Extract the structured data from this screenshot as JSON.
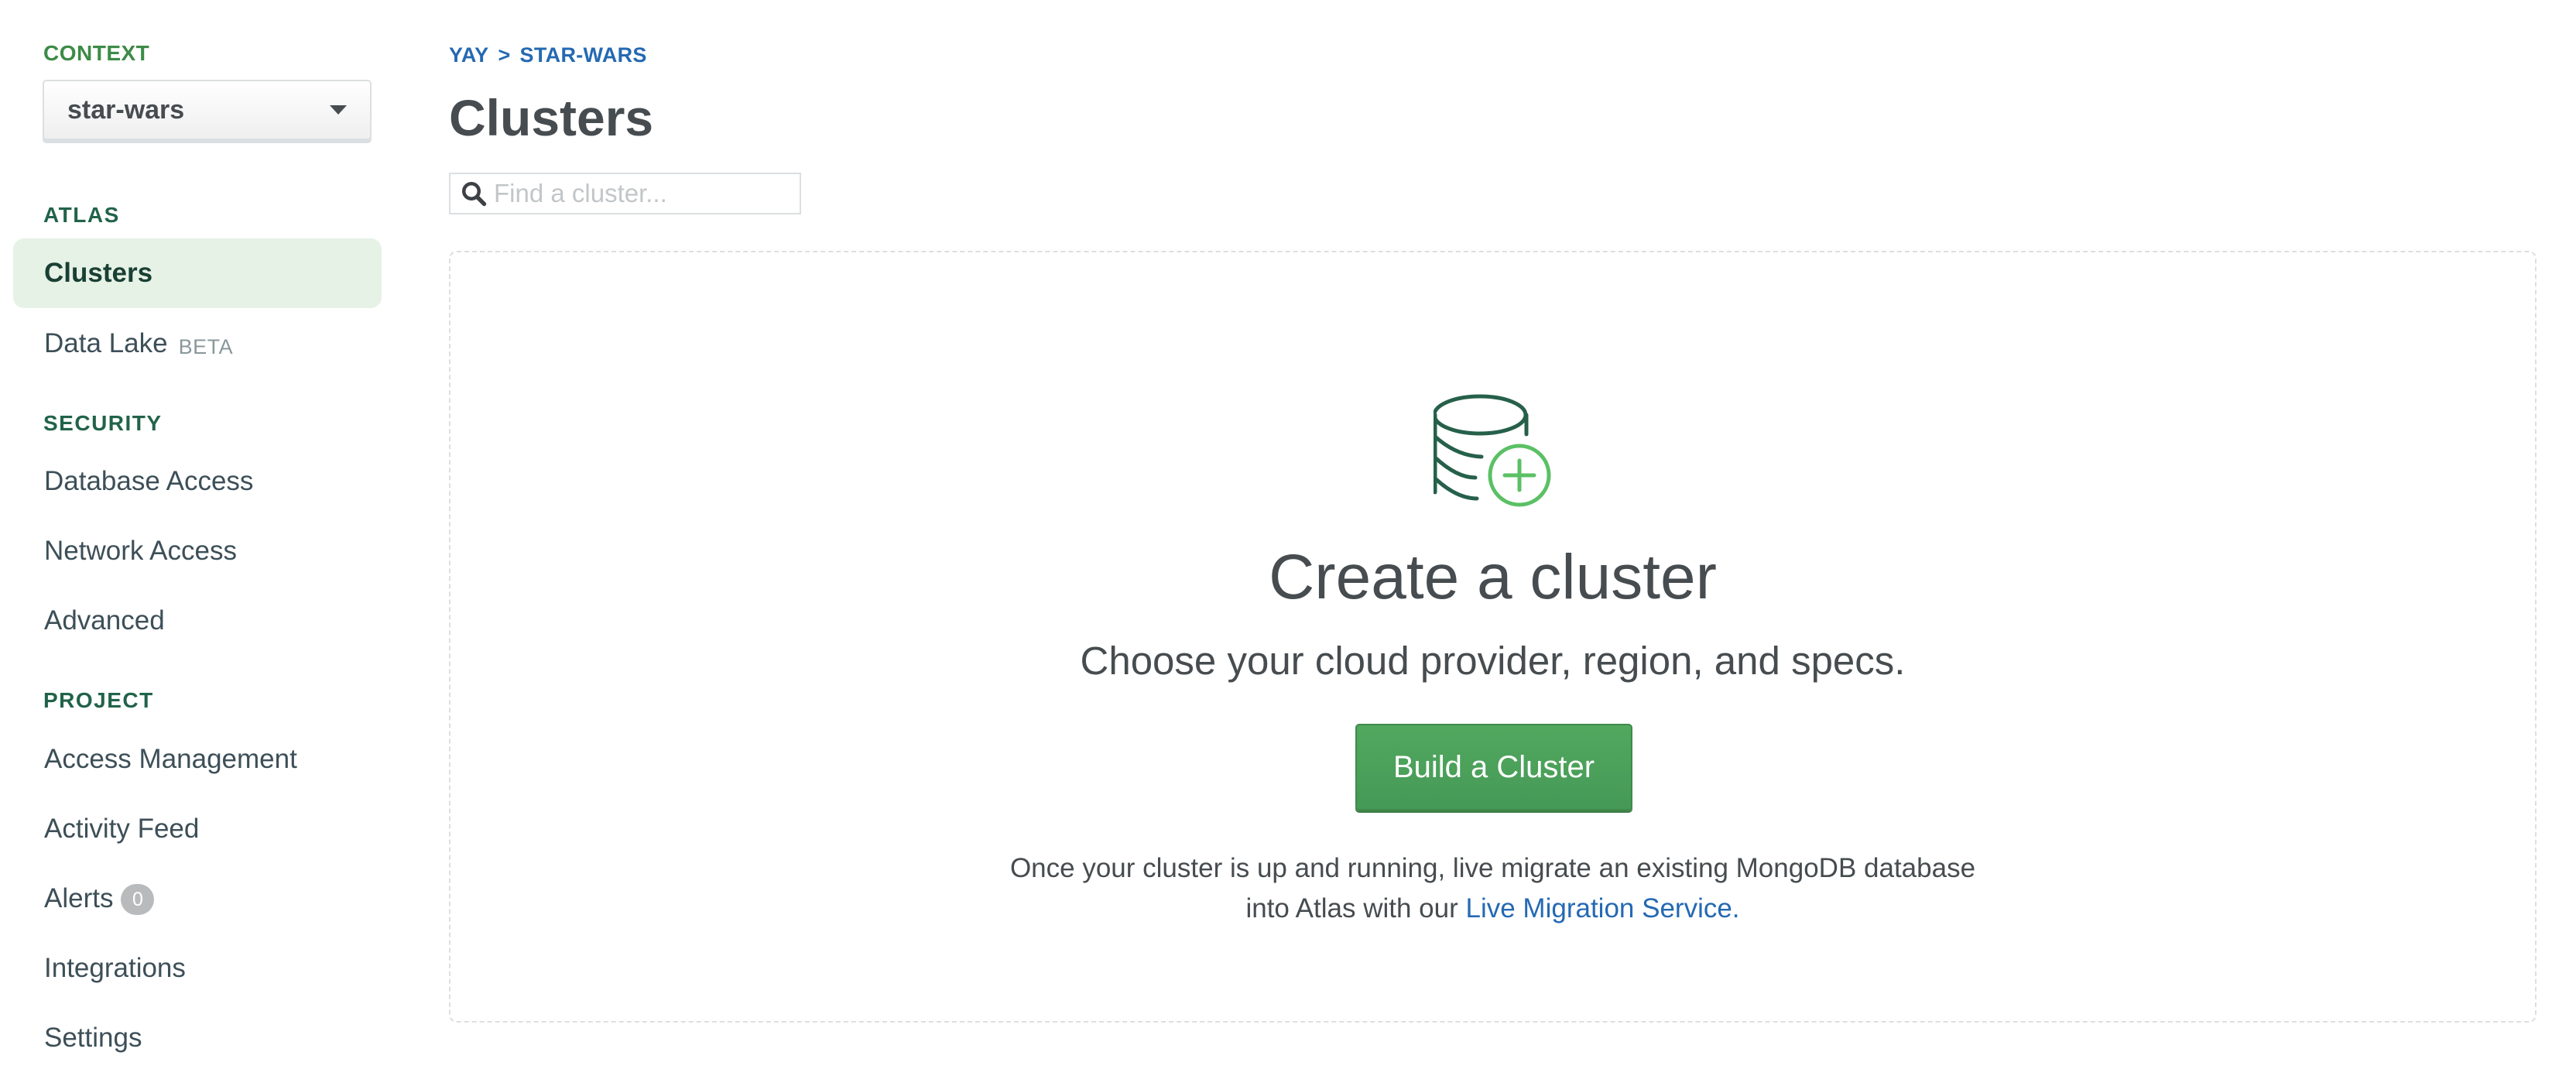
{
  "sidebar": {
    "context_label": "CONTEXT",
    "context_select": {
      "value": "star-wars"
    },
    "sections": [
      {
        "label": "ATLAS",
        "items": [
          {
            "label": "Clusters",
            "active": true
          },
          {
            "label": "Data Lake",
            "tag": "BETA"
          }
        ]
      },
      {
        "label": "SECURITY",
        "items": [
          {
            "label": "Database Access"
          },
          {
            "label": "Network Access"
          },
          {
            "label": "Advanced"
          }
        ]
      },
      {
        "label": "PROJECT",
        "items": [
          {
            "label": "Access Management"
          },
          {
            "label": "Activity Feed"
          },
          {
            "label": "Alerts",
            "badge": "0"
          },
          {
            "label": "Integrations"
          },
          {
            "label": "Settings"
          }
        ]
      }
    ]
  },
  "main": {
    "breadcrumb": [
      "YAY",
      "STAR-WARS"
    ],
    "breadcrumb_separator": ">",
    "title": "Clusters",
    "search": {
      "placeholder": "Find a cluster...",
      "value": ""
    },
    "empty_state": {
      "icon": "database-add-icon",
      "title": "Create a cluster",
      "subtitle": "Choose your cloud provider, region, and specs.",
      "button_label": "Build a Cluster",
      "description_line1": "Once your cluster is up and running, live migrate an existing MongoDB database",
      "description_line2_prefix": "into Atlas with our ",
      "description_link": "Live Migration Service."
    }
  },
  "colors": {
    "accent_green": "#3d8b47",
    "section_green": "#21634a",
    "active_bg": "#e6f2e5",
    "link_blue": "#2469b3",
    "button_green": "#4ca15a",
    "icon_dark_green": "#26604a",
    "icon_light_green": "#5bc065"
  }
}
